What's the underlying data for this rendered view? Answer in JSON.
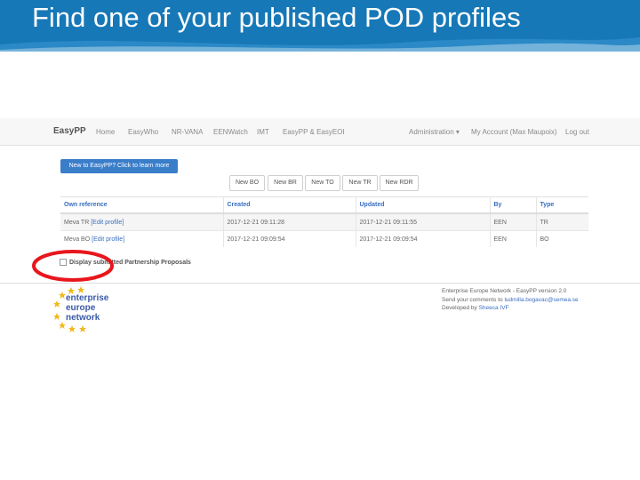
{
  "slide": {
    "title": "Find one of your published POD profiles"
  },
  "navbar": {
    "brand": "EasyPP",
    "items": [
      "Home",
      "EasyWho",
      "NR-VANA",
      "EENWatch",
      "IMT",
      "EasyPP & EasyEOI"
    ],
    "admin": "Administration ▾",
    "account": "My Account (Max Maupoix)",
    "logout": "Log out"
  },
  "learn_button": "New to EasyPP? Click to learn more",
  "new_buttons": [
    "New BO",
    "New BR",
    "New TO",
    "New TR",
    "New RDR"
  ],
  "table": {
    "headers": [
      "Own reference",
      "Created",
      "Updated",
      "By",
      "Type"
    ],
    "rows": [
      {
        "ref": "Meva TR",
        "edit": "[Edit profile]",
        "created": "2017-12-21 09:11:28",
        "updated": "2017-12-21 09:11:55",
        "by": "EEN",
        "type": "TR"
      },
      {
        "ref": "Meva BO",
        "edit": "[Edit profile]",
        "created": "2017-12-21 09:09:54",
        "updated": "2017-12-21 09:09:54",
        "by": "EEN",
        "type": "BO"
      }
    ]
  },
  "display_option": "Display submitted Partnership Proposals",
  "logo_lines": [
    "enterprise",
    "europe",
    "network"
  ],
  "footer": {
    "line1": "Enterprise Europe Network - EasyPP version 2.0",
    "line2_prefix": "Send your comments to ",
    "email": "ludmilla.bogavac@semea.se",
    "line3_prefix": "Developed by ",
    "developer": "Sheeca IVF"
  },
  "colors": {
    "header_blue": "#1778b7",
    "accent_blue": "#3a7dc9",
    "highlight_red": "#e8161c"
  }
}
